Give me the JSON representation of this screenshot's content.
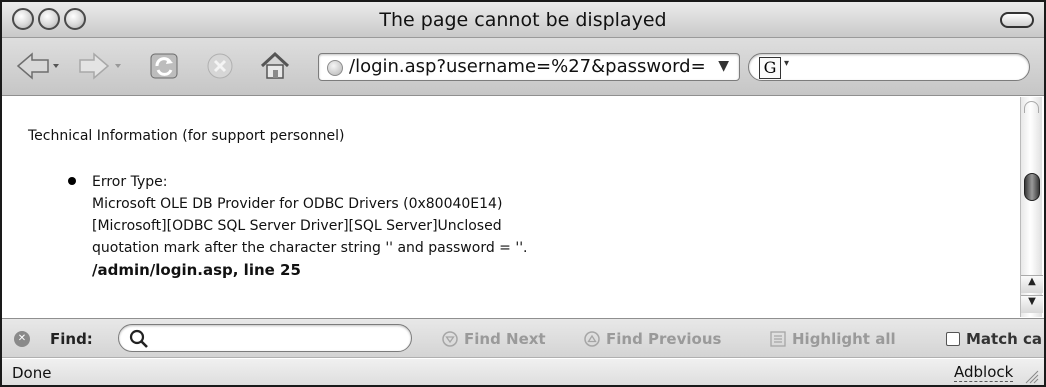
{
  "window": {
    "title": "The page cannot be displayed"
  },
  "toolbar": {
    "url": "/login.asp?username=%27&password=",
    "icons": [
      "back-arrow-icon",
      "forward-arrow-icon",
      "reload-icon",
      "stop-icon",
      "home-icon",
      "globe-icon",
      "google-search-icon"
    ]
  },
  "content": {
    "heading": "Technical Information (for support personnel)",
    "error": {
      "label": "Error Type:",
      "line1": "Microsoft OLE DB Provider for ODBC Drivers (0x80040E14)",
      "line2": "[Microsoft][ODBC SQL Server Driver][SQL Server]Unclosed",
      "line3": "quotation mark after the character string '' and password = ''.",
      "location": "/admin/login.asp, line 25"
    }
  },
  "findbar": {
    "label": "Find:",
    "input_value": "",
    "find_next": "Find Next",
    "find_previous": "Find Previous",
    "highlight_all": "Highlight all",
    "match_case": "Match ca"
  },
  "statusbar": {
    "status": "Done",
    "adblock": "Adblock"
  }
}
